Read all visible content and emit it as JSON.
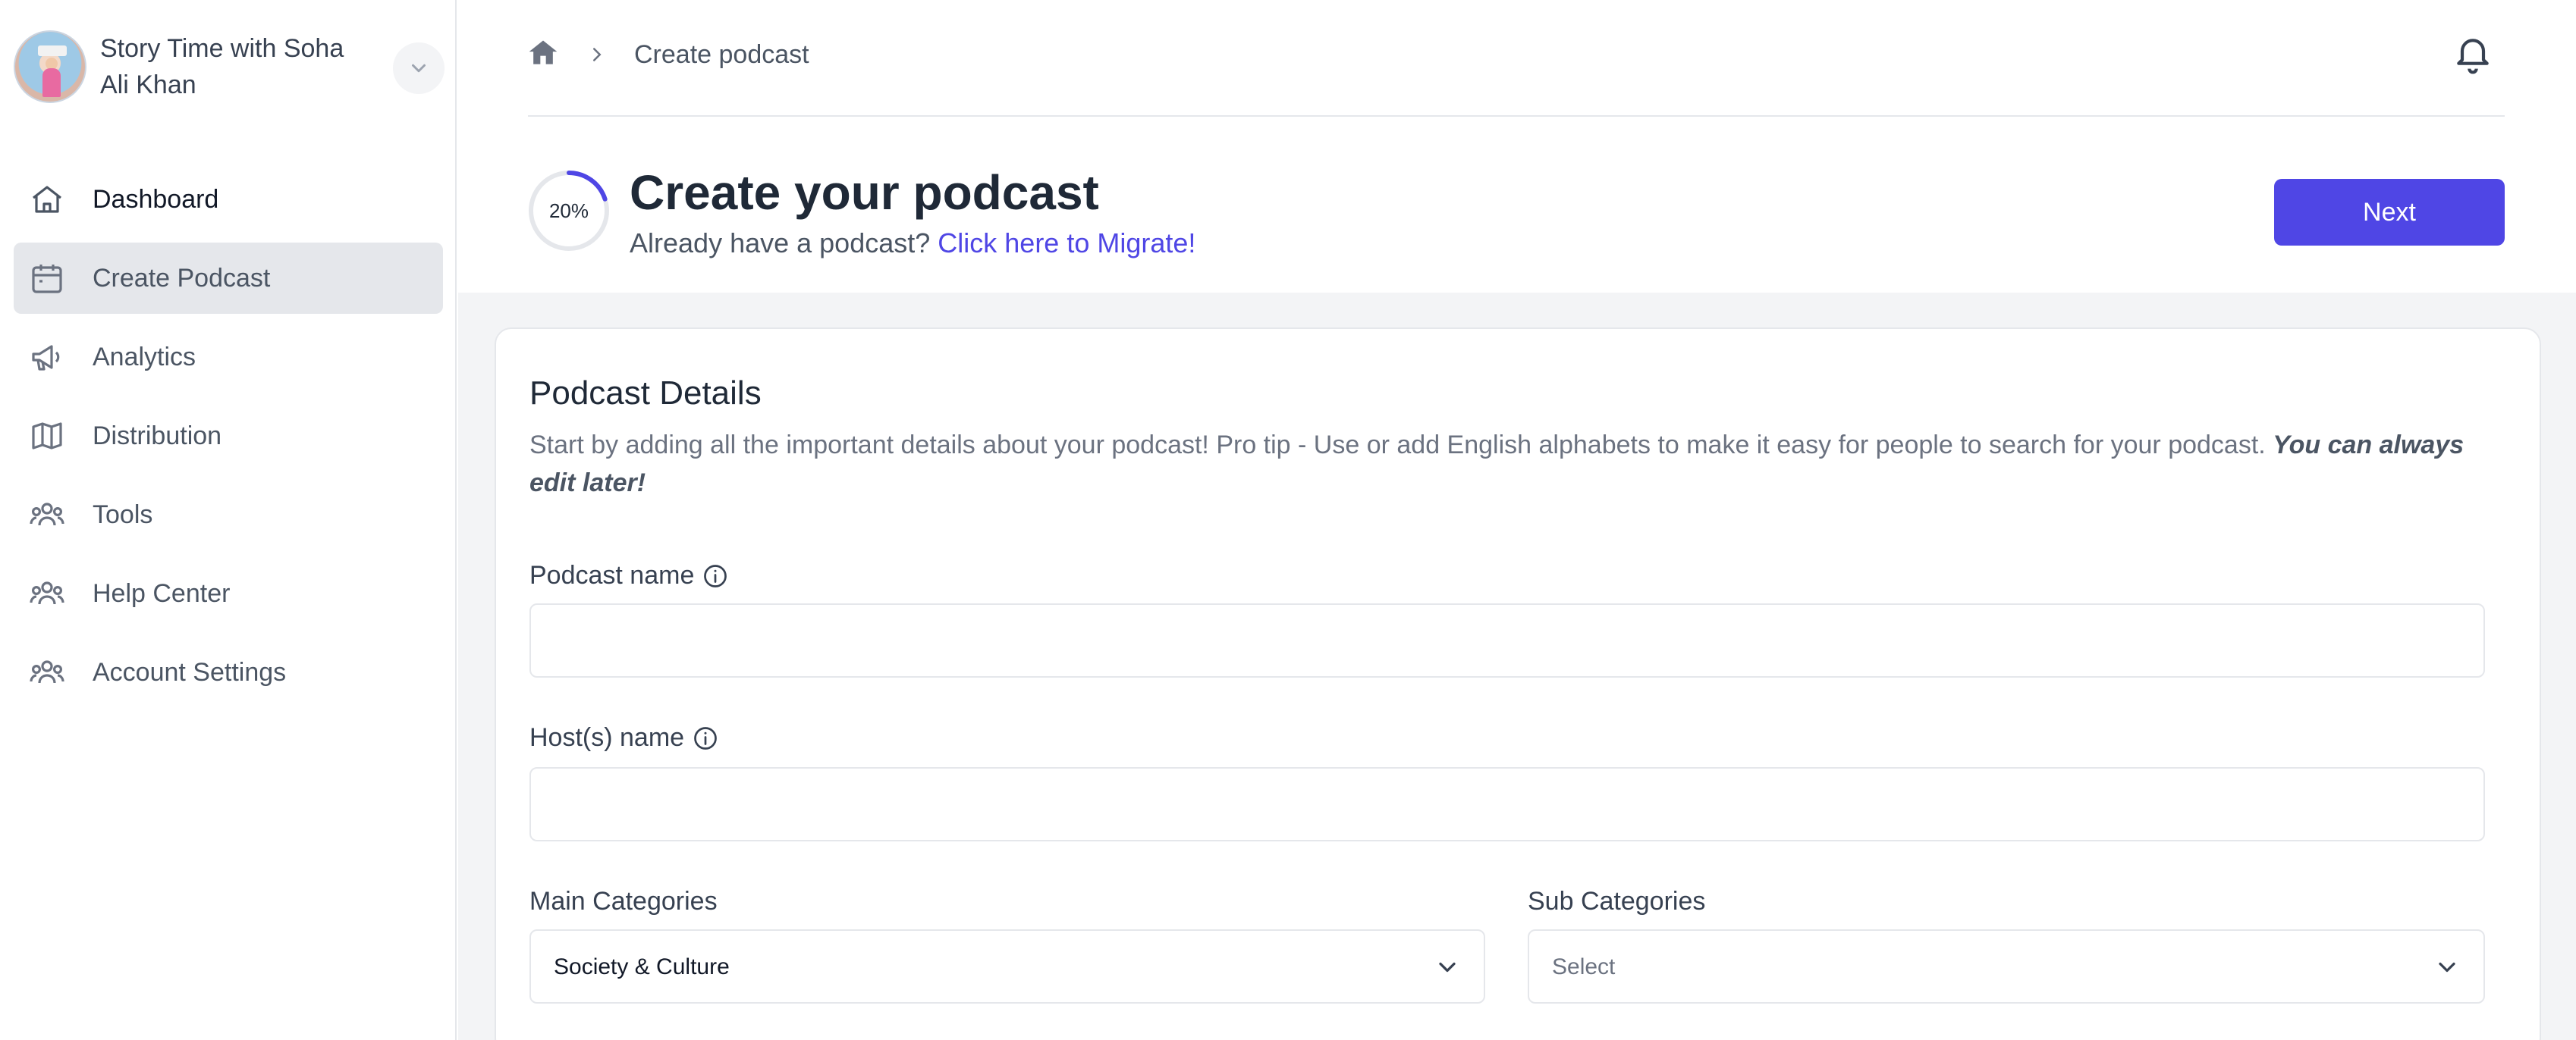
{
  "profile": {
    "name": "Story Time with Soha Ali Khan"
  },
  "sidebar": {
    "items": [
      {
        "label": "Dashboard",
        "icon": "home-icon"
      },
      {
        "label": "Create Podcast",
        "icon": "calendar-icon"
      },
      {
        "label": "Analytics",
        "icon": "megaphone-icon"
      },
      {
        "label": "Distribution",
        "icon": "map-icon"
      },
      {
        "label": "Tools",
        "icon": "users-icon"
      },
      {
        "label": "Help Center",
        "icon": "users-icon"
      },
      {
        "label": "Account Settings",
        "icon": "users-icon"
      }
    ],
    "active_index": 1
  },
  "breadcrumb": {
    "current": "Create podcast"
  },
  "header": {
    "progress_label": "20%",
    "progress_value": 0.2,
    "title": "Create your podcast",
    "subtitle_prefix": "Already have a podcast?",
    "migrate_link": "Click here to Migrate!",
    "next_label": "Next"
  },
  "form": {
    "section_title": "Podcast Details",
    "description": "Start by adding all the important details about your podcast! Pro tip - Use or add English alphabets to make it easy for people to search for your podcast.",
    "description_emphasis": "You can always edit later!",
    "podcast_name_label": "Podcast name",
    "podcast_name_value": "",
    "host_name_label": "Host(s) name",
    "host_name_value": "",
    "main_categories_label": "Main Categories",
    "main_categories_value": "Society & Culture",
    "sub_categories_label": "Sub Categories",
    "sub_categories_value": "Select"
  },
  "colors": {
    "accent": "#4f46e5",
    "active_nav_bg": "#e5e7eb",
    "content_bg": "#f3f4f6"
  }
}
